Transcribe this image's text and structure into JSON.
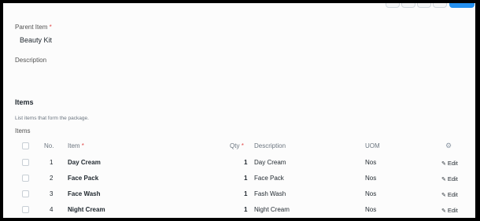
{
  "form": {
    "parent_item_label": "Parent Item",
    "required_mark": "*",
    "parent_item_value": "Beauty Kit",
    "description_label": "Description"
  },
  "items_section": {
    "title": "Items",
    "help_text": "List items that form the package.",
    "table_label": "Items",
    "columns": {
      "no": "No.",
      "item": "Item",
      "qty": "Qty",
      "description": "Description",
      "uom": "UOM"
    },
    "rows": [
      {
        "no": "1",
        "item": "Day Cream",
        "qty": "1",
        "description": "Day Cream",
        "uom": "Nos",
        "edit": "Edit"
      },
      {
        "no": "2",
        "item": "Face Pack",
        "qty": "1",
        "description": "Face Pack",
        "uom": "Nos",
        "edit": "Edit"
      },
      {
        "no": "3",
        "item": "Face Wash",
        "qty": "1",
        "description": "Fash Wash",
        "uom": "Nos",
        "edit": "Edit"
      },
      {
        "no": "4",
        "item": "Night Cream",
        "qty": "1",
        "description": "Night Cream",
        "uom": "Nos",
        "edit": "Edit"
      }
    ]
  },
  "colors": {
    "accent": "#2490ef",
    "required": "#e24c4c"
  },
  "icons": {
    "settings": "gear-icon",
    "edit": "pencil-icon"
  }
}
